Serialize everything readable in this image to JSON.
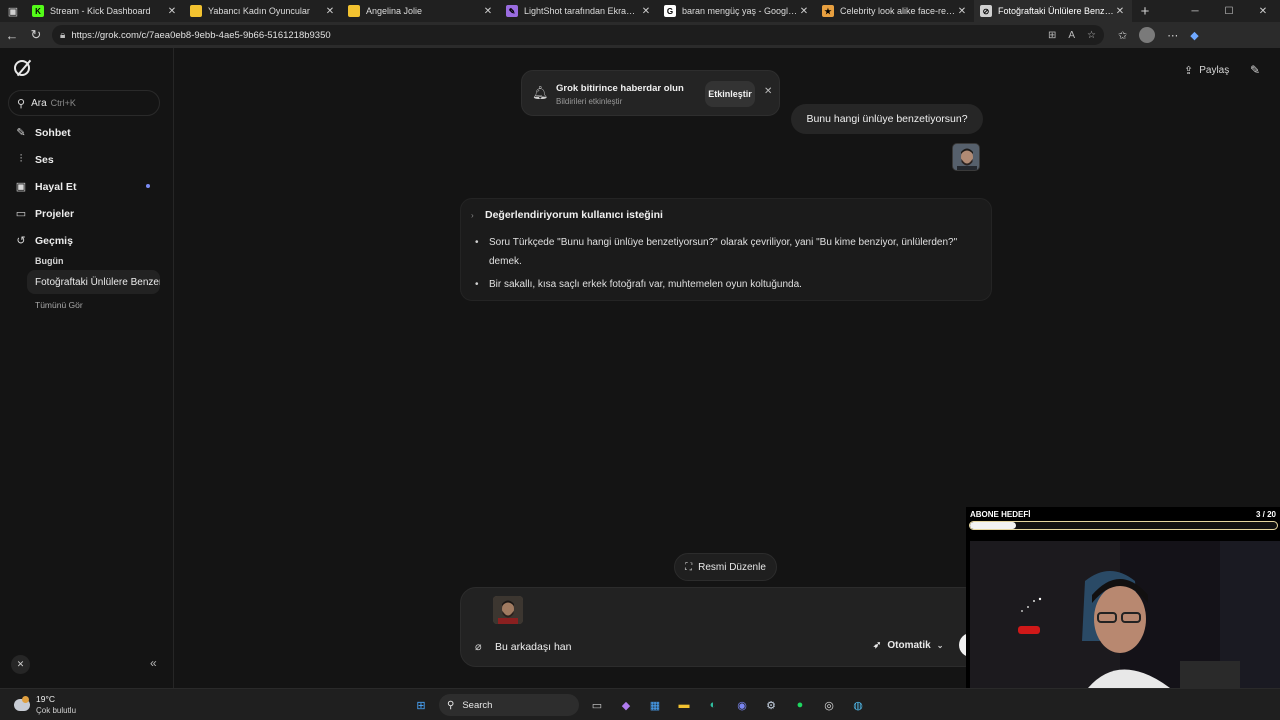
{
  "browser": {
    "tabs": [
      {
        "title": "Stream - Kick Dashboard",
        "icon": "kick-icon",
        "color": "#53fc18",
        "glyph": "K"
      },
      {
        "title": "Yabancı Kadın Oyuncular",
        "icon": "folder-icon",
        "color": "#f2c230",
        "glyph": ""
      },
      {
        "title": "Angelina Jolie",
        "icon": "folder-icon",
        "color": "#f2c230",
        "glyph": ""
      },
      {
        "title": "LightShot tarafından Ekran Görü",
        "icon": "feather-icon",
        "color": "#9a6ce0",
        "glyph": "✎"
      },
      {
        "title": "baran mengüç yaş - Google'da A",
        "icon": "google-icon",
        "color": "#ffffff",
        "glyph": "G"
      },
      {
        "title": "Celebrity look alike face-recogni",
        "icon": "star-icon",
        "color": "#e8a040",
        "glyph": "★"
      },
      {
        "title": "Fotoğraftaki Ünlülere Benzerlik A",
        "icon": "grok-icon",
        "color": "#d0d0d0",
        "glyph": "⊘"
      }
    ],
    "url": "https://grok.com/c/7aea0eb8-9ebb-4ae5-9b66-5161218b9350"
  },
  "sidebar": {
    "search_label": "Ara",
    "search_shortcut": "Ctrl+K",
    "items": [
      {
        "label": "Sohbet",
        "icon": "edit-icon"
      },
      {
        "label": "Ses",
        "icon": "voice-wave-icon"
      },
      {
        "label": "Hayal Et",
        "icon": "image-icon"
      },
      {
        "label": "Projeler",
        "icon": "folder-icon"
      },
      {
        "label": "Geçmiş",
        "icon": "history-icon"
      }
    ],
    "history_section": "Bugün",
    "history_item": "Fotoğraftaki Ünlülere Benzerlik",
    "see_all": "Tümünü Gör"
  },
  "header": {
    "share_label": "Paylaş"
  },
  "notification": {
    "title": "Grok bitirince haberdar olun",
    "subtitle": "Bildirileri etkinleştir",
    "button": "Etkinleştir"
  },
  "conversation": {
    "user_message": "Bunu hangi ünlüye benzetiyorsun?",
    "thinking_title": "Değerlendiriyorum kullanıcı isteğini",
    "thinking_points": [
      "Soru Türkçede \"Bunu hangi ünlüye benzetiyorsun?\" olarak çevriliyor, yani \"Bu kime benziyor, ünlülerden?\" demek.",
      "Bir sakallı, kısa saçlı erkek fotoğrafı var, muhtemelen oyun koltuğunda."
    ]
  },
  "composer": {
    "edit_image_label": "Resmi Düzenle",
    "input_value": "Bu arkadaşı han",
    "mode_label": "Otomatik"
  },
  "overlay": {
    "goal_title": "ABONE HEDEFİ",
    "goal_count": "3  / 20",
    "goal_progress": 0.15
  },
  "taskbar": {
    "temperature": "19°C",
    "weather": "Çok bulutlu",
    "search_label": "Search",
    "weather_badge": "1"
  }
}
